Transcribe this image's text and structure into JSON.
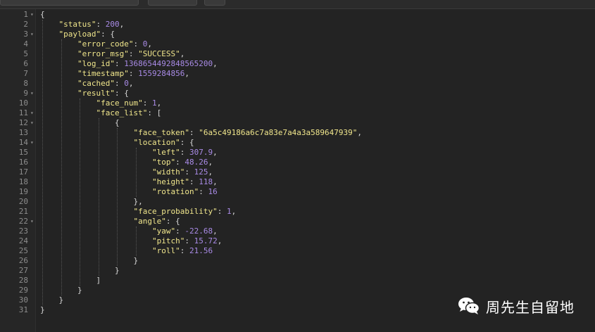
{
  "watermark": {
    "text": "周先生自留地"
  },
  "lines": [
    {
      "n": "1",
      "fold": true,
      "indent": 0,
      "t": [
        {
          "c": "p",
          "v": "{"
        }
      ]
    },
    {
      "n": "2",
      "fold": false,
      "indent": 1,
      "t": [
        {
          "c": "key",
          "v": "\"status\""
        },
        {
          "c": "p",
          "v": ": "
        },
        {
          "c": "num",
          "v": "200"
        },
        {
          "c": "p",
          "v": ","
        }
      ]
    },
    {
      "n": "3",
      "fold": true,
      "indent": 1,
      "t": [
        {
          "c": "key",
          "v": "\"payload\""
        },
        {
          "c": "p",
          "v": ": {"
        }
      ]
    },
    {
      "n": "4",
      "fold": false,
      "indent": 2,
      "t": [
        {
          "c": "key",
          "v": "\"error_code\""
        },
        {
          "c": "p",
          "v": ": "
        },
        {
          "c": "num",
          "v": "0"
        },
        {
          "c": "p",
          "v": ","
        }
      ]
    },
    {
      "n": "5",
      "fold": false,
      "indent": 2,
      "t": [
        {
          "c": "key",
          "v": "\"error_msg\""
        },
        {
          "c": "p",
          "v": ": "
        },
        {
          "c": "str",
          "v": "\"SUCCESS\""
        },
        {
          "c": "p",
          "v": ","
        }
      ]
    },
    {
      "n": "6",
      "fold": false,
      "indent": 2,
      "t": [
        {
          "c": "key",
          "v": "\"log_id\""
        },
        {
          "c": "p",
          "v": ": "
        },
        {
          "c": "num",
          "v": "1368654492848565200"
        },
        {
          "c": "p",
          "v": ","
        }
      ]
    },
    {
      "n": "7",
      "fold": false,
      "indent": 2,
      "t": [
        {
          "c": "key",
          "v": "\"timestamp\""
        },
        {
          "c": "p",
          "v": ": "
        },
        {
          "c": "num",
          "v": "1559284856"
        },
        {
          "c": "p",
          "v": ","
        }
      ]
    },
    {
      "n": "8",
      "fold": false,
      "indent": 2,
      "t": [
        {
          "c": "key",
          "v": "\"cached\""
        },
        {
          "c": "p",
          "v": ": "
        },
        {
          "c": "num",
          "v": "0"
        },
        {
          "c": "p",
          "v": ","
        }
      ]
    },
    {
      "n": "9",
      "fold": true,
      "indent": 2,
      "t": [
        {
          "c": "key",
          "v": "\"result\""
        },
        {
          "c": "p",
          "v": ": {"
        }
      ]
    },
    {
      "n": "10",
      "fold": false,
      "indent": 3,
      "t": [
        {
          "c": "key",
          "v": "\"face_num\""
        },
        {
          "c": "p",
          "v": ": "
        },
        {
          "c": "num",
          "v": "1"
        },
        {
          "c": "p",
          "v": ","
        }
      ]
    },
    {
      "n": "11",
      "fold": true,
      "indent": 3,
      "t": [
        {
          "c": "key",
          "v": "\"face_list\""
        },
        {
          "c": "p",
          "v": ": ["
        }
      ]
    },
    {
      "n": "12",
      "fold": true,
      "indent": 4,
      "t": [
        {
          "c": "p",
          "v": "{"
        }
      ]
    },
    {
      "n": "13",
      "fold": false,
      "indent": 5,
      "t": [
        {
          "c": "key",
          "v": "\"face_token\""
        },
        {
          "c": "p",
          "v": ": "
        },
        {
          "c": "str",
          "v": "\"6a5c49186a6c7a83e7a4a3a589647939\""
        },
        {
          "c": "p",
          "v": ","
        }
      ]
    },
    {
      "n": "14",
      "fold": true,
      "indent": 5,
      "t": [
        {
          "c": "key",
          "v": "\"location\""
        },
        {
          "c": "p",
          "v": ": {"
        }
      ]
    },
    {
      "n": "15",
      "fold": false,
      "indent": 6,
      "t": [
        {
          "c": "key",
          "v": "\"left\""
        },
        {
          "c": "p",
          "v": ": "
        },
        {
          "c": "num",
          "v": "307.9"
        },
        {
          "c": "p",
          "v": ","
        }
      ]
    },
    {
      "n": "16",
      "fold": false,
      "indent": 6,
      "t": [
        {
          "c": "key",
          "v": "\"top\""
        },
        {
          "c": "p",
          "v": ": "
        },
        {
          "c": "num",
          "v": "48.26"
        },
        {
          "c": "p",
          "v": ","
        }
      ]
    },
    {
      "n": "17",
      "fold": false,
      "indent": 6,
      "t": [
        {
          "c": "key",
          "v": "\"width\""
        },
        {
          "c": "p",
          "v": ": "
        },
        {
          "c": "num",
          "v": "125"
        },
        {
          "c": "p",
          "v": ","
        }
      ]
    },
    {
      "n": "18",
      "fold": false,
      "indent": 6,
      "t": [
        {
          "c": "key",
          "v": "\"height\""
        },
        {
          "c": "p",
          "v": ": "
        },
        {
          "c": "num",
          "v": "118"
        },
        {
          "c": "p",
          "v": ","
        }
      ]
    },
    {
      "n": "19",
      "fold": false,
      "indent": 6,
      "t": [
        {
          "c": "key",
          "v": "\"rotation\""
        },
        {
          "c": "p",
          "v": ": "
        },
        {
          "c": "num",
          "v": "16"
        }
      ]
    },
    {
      "n": "20",
      "fold": false,
      "indent": 5,
      "t": [
        {
          "c": "p",
          "v": "},"
        }
      ]
    },
    {
      "n": "21",
      "fold": false,
      "indent": 5,
      "t": [
        {
          "c": "key",
          "v": "\"face_probability\""
        },
        {
          "c": "p",
          "v": ": "
        },
        {
          "c": "num",
          "v": "1"
        },
        {
          "c": "p",
          "v": ","
        }
      ]
    },
    {
      "n": "22",
      "fold": true,
      "indent": 5,
      "t": [
        {
          "c": "key",
          "v": "\"angle\""
        },
        {
          "c": "p",
          "v": ": {"
        }
      ]
    },
    {
      "n": "23",
      "fold": false,
      "indent": 6,
      "t": [
        {
          "c": "key",
          "v": "\"yaw\""
        },
        {
          "c": "p",
          "v": ": "
        },
        {
          "c": "num",
          "v": "-22.68"
        },
        {
          "c": "p",
          "v": ","
        }
      ]
    },
    {
      "n": "24",
      "fold": false,
      "indent": 6,
      "t": [
        {
          "c": "key",
          "v": "\"pitch\""
        },
        {
          "c": "p",
          "v": ": "
        },
        {
          "c": "num",
          "v": "15.72"
        },
        {
          "c": "p",
          "v": ","
        }
      ]
    },
    {
      "n": "25",
      "fold": false,
      "indent": 6,
      "t": [
        {
          "c": "key",
          "v": "\"roll\""
        },
        {
          "c": "p",
          "v": ": "
        },
        {
          "c": "num",
          "v": "21.56"
        }
      ]
    },
    {
      "n": "26",
      "fold": false,
      "indent": 5,
      "t": [
        {
          "c": "p",
          "v": "}"
        }
      ]
    },
    {
      "n": "27",
      "fold": false,
      "indent": 4,
      "t": [
        {
          "c": "p",
          "v": "}"
        }
      ]
    },
    {
      "n": "28",
      "fold": false,
      "indent": 3,
      "t": [
        {
          "c": "p",
          "v": "]"
        }
      ]
    },
    {
      "n": "29",
      "fold": false,
      "indent": 2,
      "t": [
        {
          "c": "p",
          "v": "}"
        }
      ]
    },
    {
      "n": "30",
      "fold": false,
      "indent": 1,
      "t": [
        {
          "c": "p",
          "v": "}"
        }
      ]
    },
    {
      "n": "31",
      "fold": false,
      "indent": 0,
      "t": [
        {
          "c": "p",
          "v": "}"
        }
      ]
    }
  ]
}
